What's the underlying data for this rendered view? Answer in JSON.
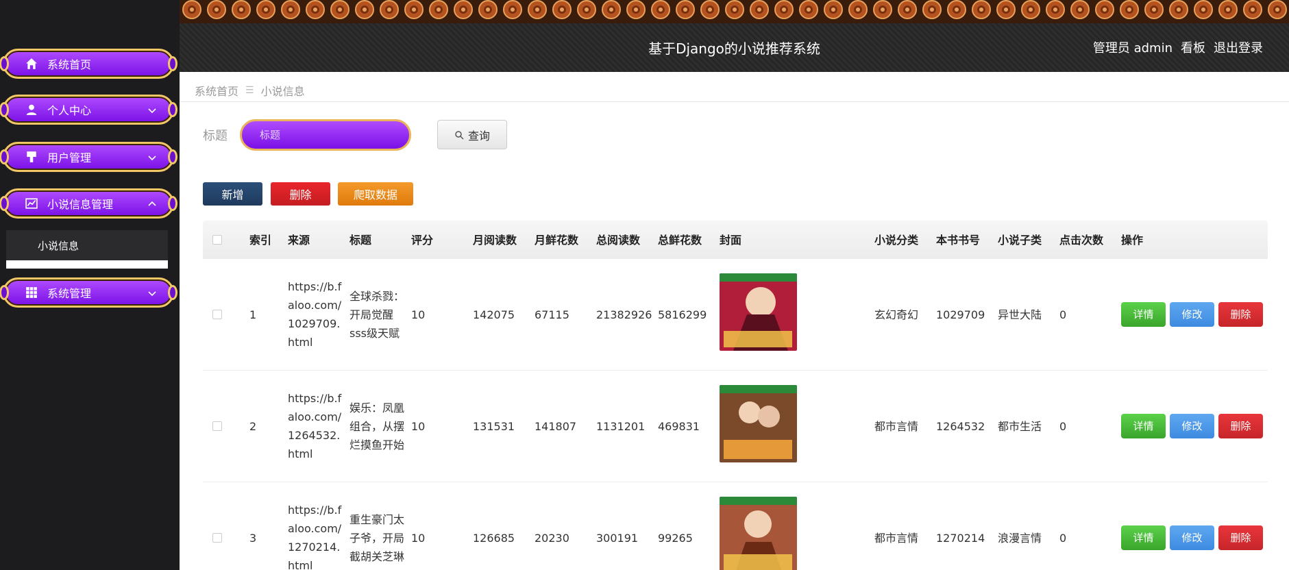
{
  "sidebar": {
    "items": [
      {
        "label": "系统首页",
        "icon": "home-icon"
      },
      {
        "label": "个人中心",
        "icon": "user-icon"
      },
      {
        "label": "用户管理",
        "icon": "tools-icon"
      },
      {
        "label": "小说信息管理",
        "icon": "chart-icon"
      },
      {
        "label": "系统管理",
        "icon": "grid-icon"
      }
    ],
    "submenu": {
      "label": "小说信息"
    }
  },
  "header": {
    "title": "基于Django的小说推荐系统",
    "user": "管理员 admin",
    "board": "看板",
    "logout": "退出登录"
  },
  "breadcrumb": {
    "home": "系统首页",
    "sep": "☰",
    "current": "小说信息"
  },
  "search": {
    "label": "标题",
    "placeholder": "标题",
    "button": "查询"
  },
  "actions": {
    "add": "新增",
    "delete": "删除",
    "crawl": "爬取数据"
  },
  "table": {
    "columns": [
      "索引",
      "来源",
      "标题",
      "评分",
      "月阅读数",
      "月鲜花数",
      "总阅读数",
      "总鲜花数",
      "封面",
      "小说分类",
      "本书书号",
      "小说子类",
      "点击次数",
      "操作"
    ],
    "ops": {
      "detail": "详情",
      "edit": "修改",
      "remove": "删除"
    },
    "rows": [
      {
        "idx": "1",
        "src": "https://b.faloo.com/1029709.html",
        "title": "全球杀戮：开局觉醒sss级天赋",
        "score": "10",
        "mr": "142075",
        "mf": "67115",
        "tr": "21382926",
        "tf": "5816299",
        "cat": "玄幻奇幻",
        "bid": "1029709",
        "sub": "异世大陆",
        "clk": "0",
        "cover_color": "#b01e3a"
      },
      {
        "idx": "2",
        "src": "https://b.faloo.com/1264532.html",
        "title": "娱乐：凤凰组合，从摆烂摸鱼开始",
        "score": "10",
        "mr": "131531",
        "mf": "141807",
        "tr": "1131201",
        "tf": "469831",
        "cat": "都市言情",
        "bid": "1264532",
        "sub": "都市生活",
        "clk": "0",
        "cover_color": "#7a4a2a"
      },
      {
        "idx": "3",
        "src": "https://b.faloo.com/1270214.html",
        "title": "重生豪门太子爷，开局截胡关芝琳",
        "score": "10",
        "mr": "126685",
        "mf": "20230",
        "tr": "300191",
        "tf": "99265",
        "cat": "都市言情",
        "bid": "1270214",
        "sub": "浪漫言情",
        "clk": "0",
        "cover_color": "#a8563a"
      }
    ]
  }
}
